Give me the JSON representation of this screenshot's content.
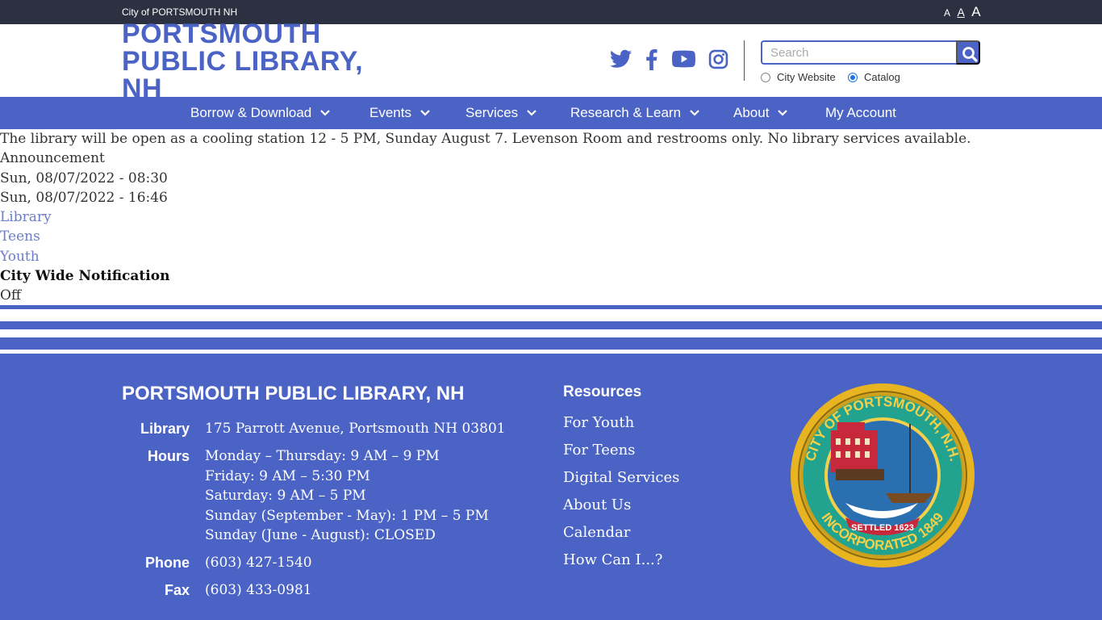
{
  "colors": {
    "brand_blue": "#4a63c5",
    "topbar": "#2c3142",
    "link": "#6b7ec9"
  },
  "topbar": {
    "city_link": "City of PORTSMOUTH NH",
    "text_size": [
      "A",
      "A",
      "A"
    ]
  },
  "header": {
    "logo_lines": [
      "PORTSMOUTH",
      "PUBLIC LIBRARY,",
      "NH"
    ],
    "social_icons": [
      "twitter-icon",
      "facebook-icon",
      "youtube-icon",
      "instagram-icon"
    ],
    "search": {
      "placeholder": "Search",
      "scope_options": [
        "City Website",
        "Catalog"
      ],
      "selected_scope": "Catalog"
    }
  },
  "nav": {
    "items": [
      {
        "label": "Borrow & Download",
        "has_dropdown": true
      },
      {
        "label": "Events",
        "has_dropdown": true
      },
      {
        "label": "Services",
        "has_dropdown": true
      },
      {
        "label": "Research & Learn",
        "has_dropdown": true
      },
      {
        "label": "About",
        "has_dropdown": true
      },
      {
        "label": "My Account",
        "has_dropdown": false
      }
    ]
  },
  "alert": {
    "message": "The library will be open as a cooling station 12 - 5 PM, Sunday August 7. Levenson Room and restrooms only. No library services available.",
    "type": "Announcement",
    "start": "Sun, 08/07/2022 - 08:30",
    "end": "Sun, 08/07/2022 - 16:46",
    "audiences": [
      "Library",
      "Teens",
      "Youth"
    ],
    "notification_label": "City Wide Notification",
    "notification_value": "Off"
  },
  "footer": {
    "title": "PORTSMOUTH PUBLIC LIBRARY, NH",
    "library_label": "Library",
    "address": "175 Parrott Avenue, Portsmouth NH 03801",
    "hours_label": "Hours",
    "hours": [
      "Monday – Thursday: 9 AM – 9 PM",
      "Friday: 9 AM – 5:30 PM",
      "Saturday: 9 AM – 5 PM",
      "Sunday (September - May): 1 PM – 5 PM",
      "Sunday (June - August): CLOSED"
    ],
    "phone_label": "Phone",
    "phone": "(603) 427-1540",
    "fax_label": "Fax",
    "fax": "(603) 433-0981",
    "resources_title": "Resources",
    "resources": [
      "For Youth",
      "For Teens",
      "Digital Services",
      "About Us",
      "Calendar",
      "How Can I...?"
    ],
    "seal": {
      "top_text": "CITY OF PORTSMOUTH, N.H.",
      "bottom_text": "INCORPORATED 1849",
      "ribbon": "SETTLED 1623"
    }
  }
}
